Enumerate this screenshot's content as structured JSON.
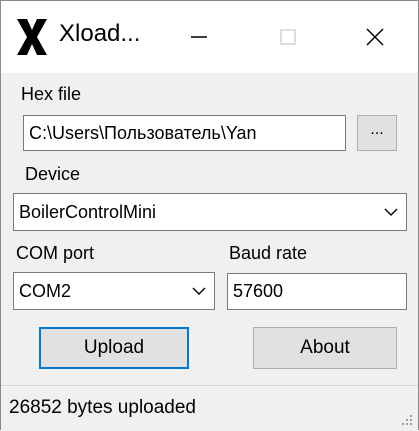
{
  "window": {
    "title": "Xload...",
    "icon": "x-logo-icon",
    "controls": {
      "minimize": "minimize-icon",
      "maximize": "maximize-icon",
      "close": "close-icon"
    }
  },
  "form": {
    "hex_file": {
      "label": "Hex file",
      "value": "C:\\Users\\Пользователь\\Yan",
      "browse_label": "..."
    },
    "device": {
      "label": "Device",
      "selected": "BoilerControlMini"
    },
    "com_port": {
      "label": "COM port",
      "selected": "COM2"
    },
    "baud_rate": {
      "label": "Baud rate",
      "value": "57600"
    },
    "upload_label": "Upload",
    "about_label": "About"
  },
  "status": {
    "text": "26852 bytes uploaded"
  },
  "colors": {
    "accent": "#0078d7",
    "window_bg": "#f0f0f0",
    "titlebar_bg": "#ffffff"
  }
}
